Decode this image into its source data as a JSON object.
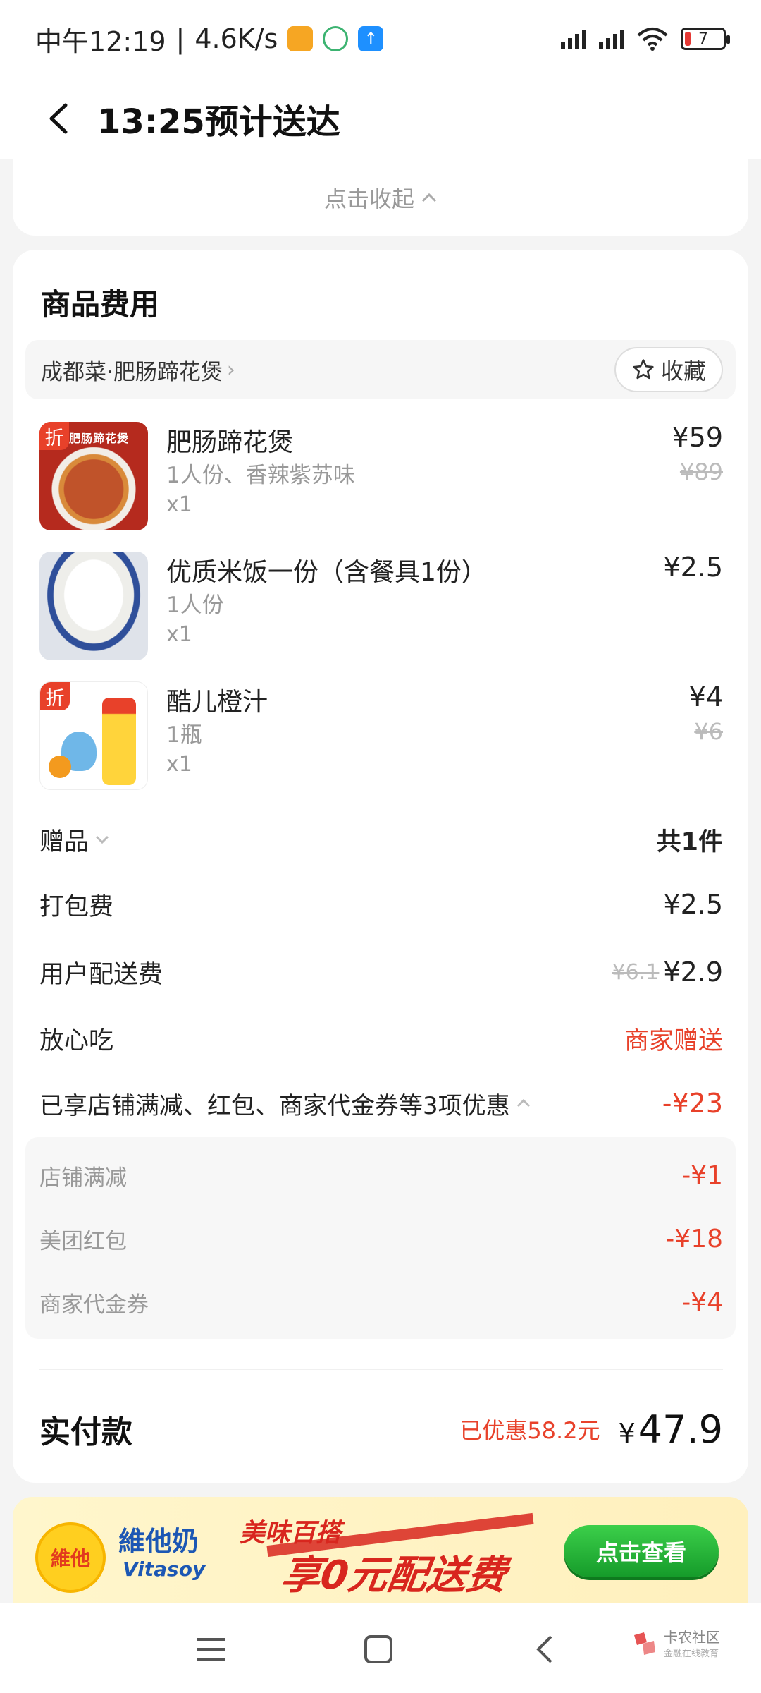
{
  "status_bar": {
    "time": "中午12:19",
    "net_speed": "4.6K/s",
    "battery": "7"
  },
  "header": {
    "title": "13:25预计送达"
  },
  "collapse": {
    "label": "点击收起"
  },
  "goods": {
    "title": "商品费用",
    "shop_name": "成都菜·肥肠蹄花煲",
    "favorite_label": "收藏",
    "items": [
      {
        "name": "肥肠蹄花煲",
        "spec": "1人份、香辣紫苏味",
        "qty": "x1",
        "price": "¥59",
        "orig_price": "¥89",
        "badge": "折",
        "thumb": "rich-stew"
      },
      {
        "name": "优质米饭一份（含餐具1份）",
        "spec": "1人份",
        "qty": "x1",
        "price": "¥2.5",
        "orig_price": "",
        "badge": "",
        "thumb": "rice-bowl"
      },
      {
        "name": "酷儿橙汁",
        "spec": "1瓶",
        "qty": "x1",
        "price": "¥4",
        "orig_price": "¥6",
        "badge": "折",
        "thumb": "qoo-drink"
      }
    ]
  },
  "fees": {
    "gift_label": "赠品",
    "gift_value": "共1件",
    "packing_label": "打包费",
    "packing_value": "¥2.5",
    "delivery_label": "用户配送费",
    "delivery_orig": "¥6.1",
    "delivery_value": "¥2.9",
    "assurance_label": "放心吃",
    "assurance_value": "商家赠送",
    "discount_summary_label": "已享店铺满减、红包、商家代金券等3项优惠",
    "discount_summary_value": "-¥23"
  },
  "discounts": [
    {
      "label": "店铺满减",
      "value": "-¥1"
    },
    {
      "label": "美团红包",
      "value": "-¥18"
    },
    {
      "label": "商家代金券",
      "value": "-¥4"
    }
  ],
  "total": {
    "label": "实付款",
    "saved": "已优惠58.2元",
    "currency": "¥",
    "amount": "47.9"
  },
  "banner": {
    "brand_cn": "維他奶",
    "brand_en": "Vitasoy",
    "logo_text": "維他",
    "promo_small": "美味百搭",
    "promo_big": "享0元配送费",
    "cta": "点击查看"
  },
  "watermark": {
    "title": "卡农社区",
    "subtitle": "金融在线教育"
  },
  "colors": {
    "accent_red": "#e8412a",
    "banner_green": "#159b2a"
  }
}
